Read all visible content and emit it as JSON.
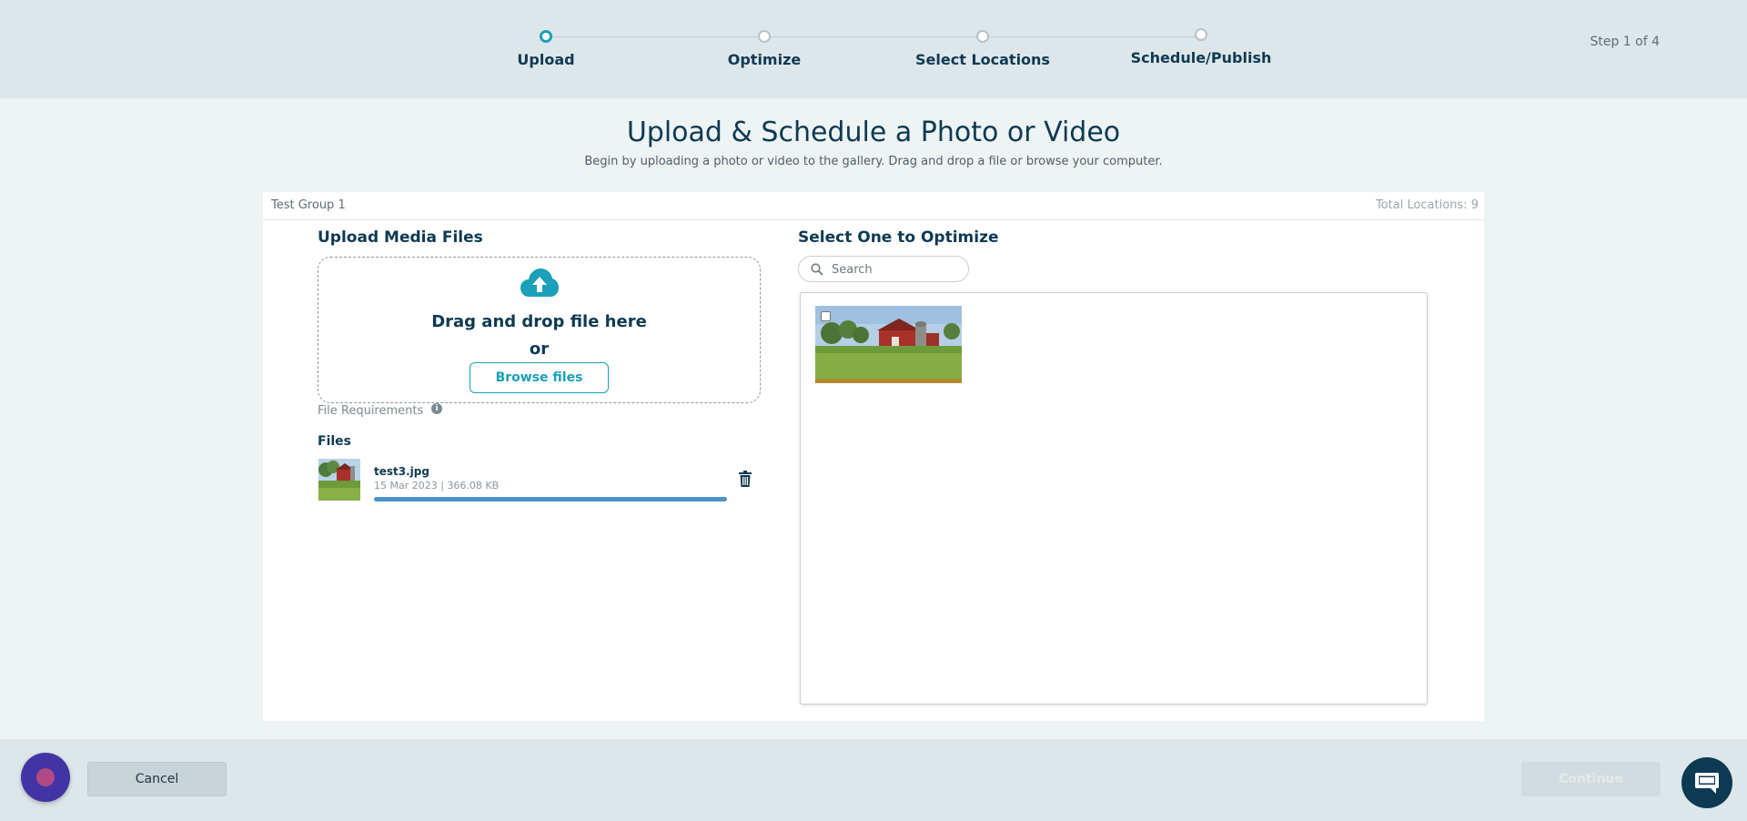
{
  "stepper": {
    "steps": [
      {
        "label": "Upload",
        "active": true
      },
      {
        "label": "Optimize",
        "active": false
      },
      {
        "label": "Select Locations",
        "active": false
      },
      {
        "label": "Schedule/Publish",
        "active": false
      }
    ],
    "counter": "Step 1 of 4"
  },
  "page": {
    "title": "Upload & Schedule a Photo or Video",
    "subtitle": "Begin by uploading a photo or video to the gallery. Drag and drop a file or browse your computer."
  },
  "panel": {
    "group_name": "Test Group 1",
    "total_locations": "Total Locations: 9"
  },
  "upload": {
    "title": "Upload Media Files",
    "drag_text": "Drag and drop file here",
    "or_text": "or",
    "browse_label": "Browse files",
    "requirements_label": "File Requirements",
    "files_title": "Files",
    "files": [
      {
        "name": "test3.jpg",
        "meta": "15 Mar 2023 |  366.08 KB",
        "progress": 1.0
      }
    ]
  },
  "optimize": {
    "title": "Select One to Optimize",
    "search_placeholder": "Search",
    "gallery_checked": false
  },
  "footer": {
    "cancel_label": "Cancel",
    "continue_label": "Continue"
  },
  "colors": {
    "accent": "#1aa0b8",
    "primary_text": "#0d3a52",
    "progress": "#4e93c7",
    "chat_button": "#0b3a52",
    "assistant_button": "#4234a4"
  },
  "icons": {
    "upload": "cloud-upload-icon",
    "info": "info-icon",
    "delete": "trash-icon",
    "search": "search-icon",
    "chat": "chat-bubble-icon"
  }
}
